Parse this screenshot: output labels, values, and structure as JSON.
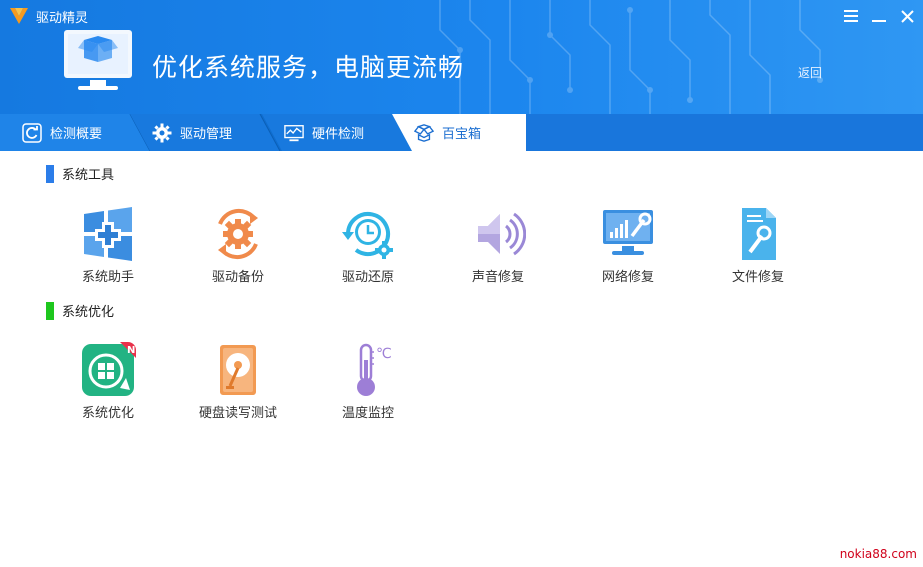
{
  "app": {
    "title": "驱动精灵"
  },
  "window": {
    "controls": [
      "menu-icon",
      "minimize-icon",
      "close-icon"
    ]
  },
  "hero": {
    "text": "优化系统服务，电脑更流畅",
    "back_label": "返回"
  },
  "tabs": [
    {
      "label": "检测概要",
      "icon": "refresh-icon",
      "active": false
    },
    {
      "label": "驱动管理",
      "icon": "gear-icon",
      "active": false
    },
    {
      "label": "硬件检测",
      "icon": "monitor-chart-icon",
      "active": false
    },
    {
      "label": "百宝箱",
      "icon": "toolbox-icon",
      "active": true
    }
  ],
  "sections": [
    {
      "title": "系统工具",
      "accent": "#2b7de9",
      "tools": [
        {
          "label": "系统助手",
          "icon": "windows-plus-icon"
        },
        {
          "label": "驱动备份",
          "icon": "gear-backup-icon"
        },
        {
          "label": "驱动还原",
          "icon": "clock-restore-icon"
        },
        {
          "label": "声音修复",
          "icon": "speaker-icon"
        },
        {
          "label": "网络修复",
          "icon": "network-repair-icon"
        },
        {
          "label": "文件修复",
          "icon": "file-repair-icon"
        }
      ]
    },
    {
      "title": "系统优化",
      "accent": "#1ec71e",
      "tools": [
        {
          "label": "系统优化",
          "icon": "optimize-icon",
          "badge": "N"
        },
        {
          "label": "硬盘读写测试",
          "icon": "harddisk-icon"
        },
        {
          "label": "温度监控",
          "icon": "thermometer-icon",
          "unit": "℃"
        }
      ]
    }
  ],
  "watermark": "nokia88.com",
  "colors": {
    "header": "#1c86ee",
    "tabbar": "#0f6ed0",
    "active_tab": "#ffffff"
  }
}
